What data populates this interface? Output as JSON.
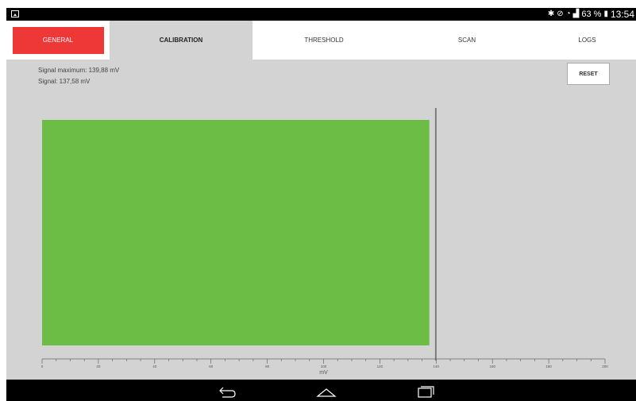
{
  "status_bar": {
    "battery_percent": "63 %",
    "time": "13:54",
    "icons": [
      "image-icon",
      "bluetooth-icon",
      "mute-icon",
      "wifi-icon",
      "signal-icon",
      "battery-icon"
    ]
  },
  "tabs": [
    {
      "label": "GENERAL",
      "state": "highlighted"
    },
    {
      "label": "CALIBRATION",
      "state": "selected"
    },
    {
      "label": "THRESHOLD",
      "state": "normal"
    },
    {
      "label": "SCAN",
      "state": "normal"
    },
    {
      "label": "LOGS",
      "state": "normal"
    }
  ],
  "readouts": {
    "signal_maximum": "Signal maximum: 139,88 mV",
    "signal": "Signal: 137,58 mV"
  },
  "reset_label": "RESET",
  "colors": {
    "bar": "#6cbd45",
    "general_button": "#ee3838",
    "panel_background": "#d3d3d3",
    "marker": "#7a7a7a"
  },
  "chart_data": {
    "type": "bar",
    "orientation": "horizontal",
    "series": [
      {
        "values": [
          137.58
        ]
      }
    ],
    "max_marker": 139.88,
    "xlabel": "mV",
    "xlim": [
      0,
      200
    ],
    "x_ticks": [
      0,
      20,
      40,
      60,
      80,
      100,
      120,
      140,
      160,
      180,
      200
    ],
    "grid": false
  },
  "nav_bar": {
    "buttons": [
      "back-icon",
      "home-icon",
      "recent-apps-icon"
    ]
  }
}
